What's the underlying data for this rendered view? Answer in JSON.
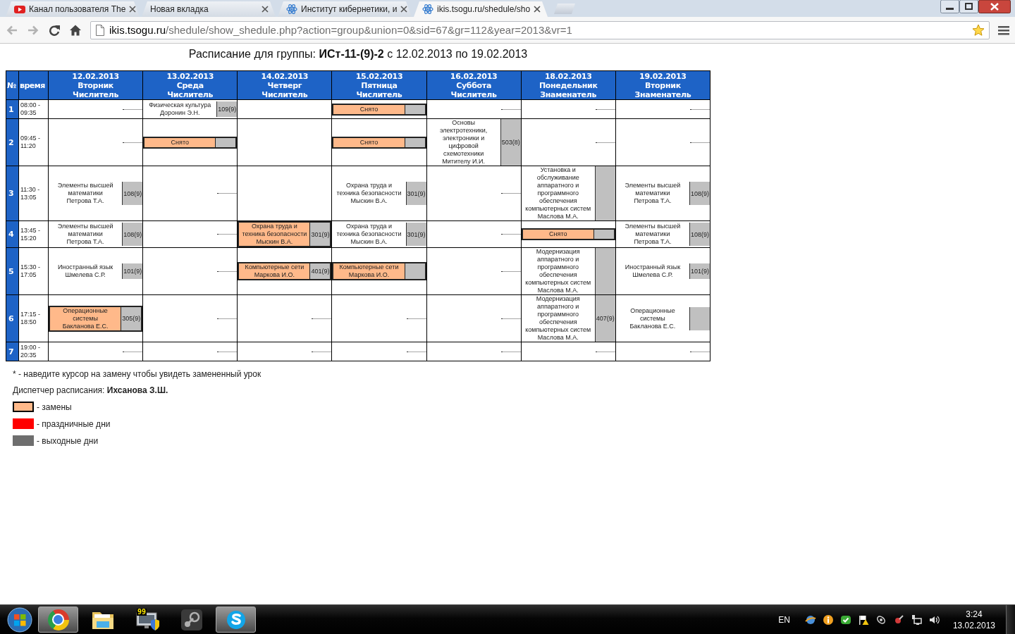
{
  "browser": {
    "tabs": [
      {
        "title": "Канал пользователя The",
        "selected": false
      },
      {
        "title": "Новая вкладка",
        "selected": false
      },
      {
        "title": "Институт кибернетики, и",
        "selected": false
      },
      {
        "title": "ikis.tsogu.ru/shedule/sho",
        "selected": true
      }
    ],
    "nav": {
      "back_enabled": false,
      "forward_enabled": false
    },
    "address": {
      "host": "ikis.tsogu.ru",
      "path": "/shedule/show_shedule.php?action=group&union=0&sid=67&gr=112&year=2013&vr=1"
    }
  },
  "heading": "Расписание для группы: **ИСт-11-(9)-2** с 12.02.2013 по 19.02.2013",
  "schedule": {
    "columns": {
      "number": "№",
      "time": "время"
    },
    "days": [
      {
        "date": "12.02.2013",
        "weekday": "Вторник",
        "week": "Числитель"
      },
      {
        "date": "13.02.2013",
        "weekday": "Среда",
        "week": "Числитель"
      },
      {
        "date": "14.02.2013",
        "weekday": "Четверг",
        "week": "Числитель"
      },
      {
        "date": "15.02.2013",
        "weekday": "Пятница",
        "week": "Числитель"
      },
      {
        "date": "16.02.2013",
        "weekday": "Суббота",
        "week": "Числитель"
      },
      {
        "date": "18.02.2013",
        "weekday": "Понедельник",
        "week": "Знаменатель"
      },
      {
        "date": "19.02.2013",
        "weekday": "Вторник",
        "week": "Знаменатель"
      }
    ],
    "rows": [
      {
        "number": "1",
        "time": "08:00 - 09:35",
        "cells": [
          {
            "kind": "empty"
          },
          {
            "kind": "lesson",
            "subject": "Физическая культура",
            "teacher": "Доронин Э.Н.",
            "room": "109(9)",
            "replaced": false
          },
          {
            "kind": "blank"
          },
          {
            "kind": "cancelled",
            "label": "Снято"
          },
          {
            "kind": "empty"
          },
          {
            "kind": "empty"
          },
          {
            "kind": "empty"
          }
        ]
      },
      {
        "number": "2",
        "time": "09:45 - 11:20",
        "cells": [
          {
            "kind": "empty"
          },
          {
            "kind": "cancelled",
            "label": "Снято"
          },
          {
            "kind": "blank"
          },
          {
            "kind": "cancelled",
            "label": "Снято"
          },
          {
            "kind": "lesson",
            "subject": "Основы\nэлектротехники,\nэлектроники и\nцифровой\nсхемотехники",
            "teacher": "Митителу И.И.",
            "room": "503(8)",
            "replaced": false
          },
          {
            "kind": "empty"
          },
          {
            "kind": "empty"
          }
        ]
      },
      {
        "number": "3",
        "time": "11:30 - 13:05",
        "cells": [
          {
            "kind": "lesson",
            "subject": "Элементы высшей\nматематики",
            "teacher": "Петрова Т.А.",
            "room": "108(9)",
            "replaced": false
          },
          {
            "kind": "empty"
          },
          {
            "kind": "blank"
          },
          {
            "kind": "lesson",
            "subject": "Охрана труда и\nтехника безопасности",
            "teacher": "Мыскин В.А.",
            "room": "301(9)",
            "replaced": false
          },
          {
            "kind": "empty"
          },
          {
            "kind": "lesson",
            "subject": "Установка и\nобслуживание\nаппаратного и\nпрограммного\nобеспечения\nкомпьютерных систем",
            "teacher": "Маслова М.А.",
            "replaced": false
          },
          {
            "kind": "lesson",
            "subject": "Элементы высшей\nматематики",
            "teacher": "Петрова Т.А.",
            "room": "108(9)",
            "replaced": false
          }
        ]
      },
      {
        "number": "4",
        "time": "13:45 - 15:20",
        "cells": [
          {
            "kind": "lesson",
            "subject": "Элементы высшей\nматематики",
            "teacher": "Петрова Т.А.",
            "room": "108(9)",
            "replaced": false
          },
          {
            "kind": "empty"
          },
          {
            "kind": "lesson",
            "subject": "Охрана труда и\nтехника безопасности",
            "teacher": "Мыскин В.А.",
            "room": "301(9)",
            "replaced": true
          },
          {
            "kind": "lesson",
            "subject": "Охрана труда и\nтехника безопасности",
            "teacher": "Мыскин В.А.",
            "room": "301(9)",
            "replaced": false
          },
          {
            "kind": "empty"
          },
          {
            "kind": "cancelled",
            "label": "Снято"
          },
          {
            "kind": "lesson",
            "subject": "Элементы высшей\nматематики",
            "teacher": "Петрова Т.А.",
            "room": "108(9)",
            "replaced": false
          }
        ]
      },
      {
        "number": "5",
        "time": "15:30 - 17:05",
        "cells": [
          {
            "kind": "lesson",
            "subject": "Иностранный язык",
            "teacher": "Шмелева С.Р.",
            "room": "101(9)",
            "replaced": false
          },
          {
            "kind": "empty"
          },
          {
            "kind": "lesson",
            "subject": "Компьютерные сети",
            "teacher": "Маркова И.О.",
            "room": "401(9)",
            "replaced": true
          },
          {
            "kind": "lesson",
            "subject": "Компьютерные сети",
            "teacher": "Маркова И.О.",
            "replaced": true
          },
          {
            "kind": "empty"
          },
          {
            "kind": "lesson",
            "subject": "Модернизация\nаппаратного и\nпрограммного\nобеспечения\nкомпьютерных систем",
            "teacher": "Маслова М.А.",
            "replaced": false
          },
          {
            "kind": "lesson",
            "subject": "Иностранный язык",
            "teacher": "Шмелева С.Р.",
            "room": "101(9)",
            "replaced": false
          }
        ]
      },
      {
        "number": "6",
        "time": "17:15 - 18:50",
        "cells": [
          {
            "kind": "lesson",
            "subject": "Операционные\nсистемы",
            "teacher": "Бакланова Е.С.",
            "room": "305(9)",
            "replaced": true
          },
          {
            "kind": "empty"
          },
          {
            "kind": "empty"
          },
          {
            "kind": "empty"
          },
          {
            "kind": "empty"
          },
          {
            "kind": "lesson",
            "subject": "Модернизация\nаппаратного и\nпрограммного\nобеспечения\nкомпьютерных систем",
            "teacher": "Маслова М.А.",
            "room": "407(9)",
            "replaced": false
          },
          {
            "kind": "lesson",
            "subject": "Операционные\nсистемы",
            "teacher": "Бакланова Е.С.",
            "replaced": false
          }
        ]
      },
      {
        "number": "7",
        "time": "19:00 - 20:35",
        "cells": [
          {
            "kind": "empty"
          },
          {
            "kind": "empty"
          },
          {
            "kind": "empty"
          },
          {
            "kind": "empty"
          },
          {
            "kind": "empty"
          },
          {
            "kind": "empty"
          },
          {
            "kind": "empty"
          }
        ]
      }
    ]
  },
  "notes": {
    "hint": "* - наведите курсор на замену чтобы увидеть замененный урок",
    "dispatcher": "Диспетчер расписания: **Ихсанова З.Ш.**"
  },
  "legend": [
    {
      "color": "#ffb98a",
      "outlined": true,
      "label": "- замены"
    },
    {
      "color": "#ff0000",
      "outlined": false,
      "label": "- праздничные дни"
    },
    {
      "color": "#6e6e6e",
      "outlined": false,
      "label": "- выходные дни"
    }
  ],
  "taskbar": {
    "apps": [
      {
        "running": true
      },
      {
        "running": false
      },
      {
        "running": false,
        "badge": "99"
      },
      {
        "running": false
      },
      {
        "running": true
      }
    ],
    "language": "EN",
    "time": "3:24",
    "date": "13.02.2013"
  }
}
